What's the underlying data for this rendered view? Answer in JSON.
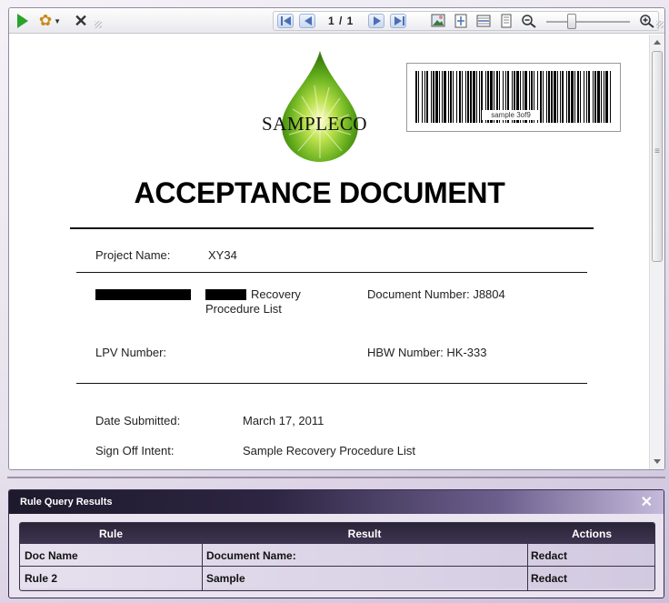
{
  "toolbar": {
    "page_indicator": "1 / 1"
  },
  "document": {
    "logo_text": "SAMPLECO",
    "barcode_text": "sample 3of9",
    "title": "ACCEPTANCE DOCUMENT",
    "project_name_label": "Project Name:",
    "project_name_value": "XY34",
    "procedure_text_line1": "Recovery",
    "procedure_text_line2": "Procedure List",
    "document_number": "Document Number: J8804",
    "lpv_number_label": "LPV Number:",
    "hbw_number": "HBW Number: HK-333",
    "date_submitted_label": "Date Submitted:",
    "date_submitted_value": "March 17, 2011",
    "sign_off_label": "Sign Off Intent:",
    "sign_off_value": "Sample Recovery Procedure List"
  },
  "rule_query": {
    "title": "Rule Query Results",
    "close_glyph": "✕",
    "columns": [
      "Rule",
      "Result",
      "Actions"
    ],
    "rows": [
      {
        "rule": "Doc Name",
        "result": "Document Name:",
        "action": "Redact"
      },
      {
        "rule": "Rule 2",
        "result": "Sample",
        "action": "Redact"
      }
    ]
  },
  "colors": {
    "accent_purple": "#2d2542",
    "play_green": "#2aa32a",
    "logo_green": "#6cbf1f"
  },
  "icons": [
    "play-icon",
    "gear-icon",
    "close-icon",
    "first-page-icon",
    "prev-page-icon",
    "next-page-icon",
    "last-page-icon",
    "image-icon",
    "fit-page-icon",
    "fit-width-icon",
    "single-page-icon",
    "zoom-out-icon",
    "zoom-in-icon"
  ]
}
